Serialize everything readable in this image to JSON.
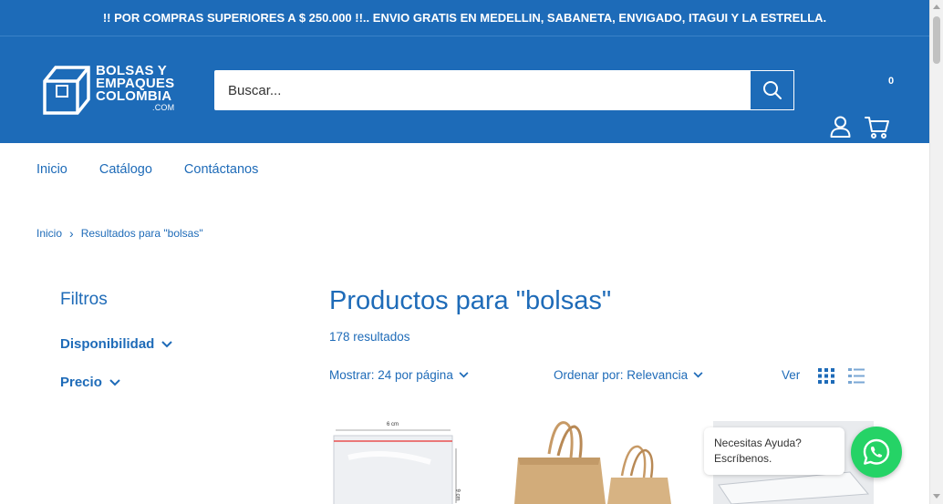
{
  "announcement": "!! POR COMPRAS SUPERIORES A $ 250.000 !!.. ENVIO GRATIS EN MEDELLIN, SABANETA, ENVIGADO, ITAGUI Y LA ESTRELLA.",
  "logo": {
    "line1": "BOLSAS Y",
    "line2": "EMPAQUES",
    "line3": "COLOMBIA",
    "line4": ".COM"
  },
  "search": {
    "placeholder": "Buscar..."
  },
  "cart": {
    "count": "0"
  },
  "nav": [
    "Inicio",
    "Catálogo",
    "Contáctanos"
  ],
  "breadcrumb": {
    "home": "Inicio",
    "separator": "›",
    "current": "Resultados para \"bolsas\""
  },
  "filters": {
    "title": "Filtros",
    "availability": "Disponibilidad",
    "price": "Precio"
  },
  "results": {
    "title": "Productos para \"bolsas\"",
    "count": "178 resultados"
  },
  "toolbar": {
    "show": "Mostrar: 24 por página",
    "sort": "Ordenar por: Relevancia",
    "view": "Ver"
  },
  "product_labels": {
    "dim_top": "6 cm",
    "dim_side": "9 cm"
  },
  "whatsapp": {
    "line1": "Necesitas Ayuda?",
    "line2": "Escríbenos."
  },
  "colors": {
    "brand": "#1d6bb8",
    "whatsapp": "#25d366"
  }
}
